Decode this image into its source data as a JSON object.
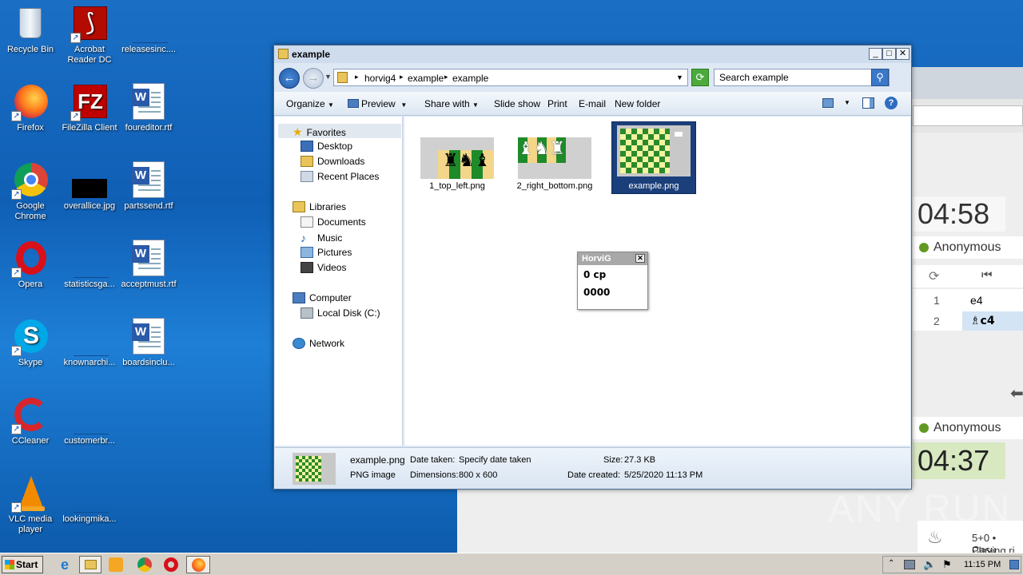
{
  "desktop": {
    "icons": [
      {
        "label": "Recycle Bin"
      },
      {
        "label": "Acrobat Reader DC"
      },
      {
        "label": "releasesinc...."
      },
      {
        "label": "Firefox"
      },
      {
        "label": "FileZilla Client"
      },
      {
        "label": "foureditor.rtf"
      },
      {
        "label": "Google Chrome"
      },
      {
        "label": "overallice.jpg"
      },
      {
        "label": "partssend.rtf"
      },
      {
        "label": "Opera"
      },
      {
        "label": "statisticsga..."
      },
      {
        "label": "acceptmust.rtf"
      },
      {
        "label": "Skype"
      },
      {
        "label": "knownarchi..."
      },
      {
        "label": "boardsinclu..."
      },
      {
        "label": "CCleaner"
      },
      {
        "label": "customerbr..."
      },
      {
        "label": "VLC media player"
      },
      {
        "label": "lookingmika..."
      }
    ],
    "watermark": "ANY RUN"
  },
  "explorer": {
    "title": "example",
    "breadcrumb": [
      "horvig4",
      "example",
      "example"
    ],
    "search_placeholder": "Search example",
    "toolbar": [
      "Organize",
      "Preview",
      "Share with",
      "Slide show",
      "Print",
      "E-mail",
      "New folder"
    ],
    "nav": {
      "favorites": "Favorites",
      "fav_items": [
        "Desktop",
        "Downloads",
        "Recent Places"
      ],
      "libraries": "Libraries",
      "lib_items": [
        "Documents",
        "Music",
        "Pictures",
        "Videos"
      ],
      "computer": "Computer",
      "drive": "Local Disk (C:)",
      "network": "Network"
    },
    "files": [
      {
        "name": "1_top_left.png"
      },
      {
        "name": "2_right_bottom.png"
      },
      {
        "name": "example.png"
      }
    ],
    "details": {
      "filename": "example.png",
      "type": "PNG image",
      "date_taken_label": "Date taken:",
      "date_taken": "Specify date taken",
      "dimensions_label": "Dimensions:",
      "dimensions": "800 x 600",
      "size_label": "Size:",
      "size": "27.3 KB",
      "created_label": "Date created:",
      "created": "5/25/2020 11:13 PM"
    }
  },
  "horvig": {
    "title": "HorviG",
    "score": "0 cp",
    "code": "0000"
  },
  "chess_site": {
    "timer_top": "04:58",
    "player_top": "Anonymous",
    "moves": [
      {
        "n": "1",
        "m": "e4"
      },
      {
        "n": "2",
        "m": "♗c4"
      }
    ],
    "timer_bottom": "04:37",
    "player_bottom": "Anonymous",
    "game_info": "5+0 • Casu",
    "game_sub": "Playing ri"
  },
  "taskbar": {
    "start": "Start",
    "clock": "11:15 PM"
  }
}
